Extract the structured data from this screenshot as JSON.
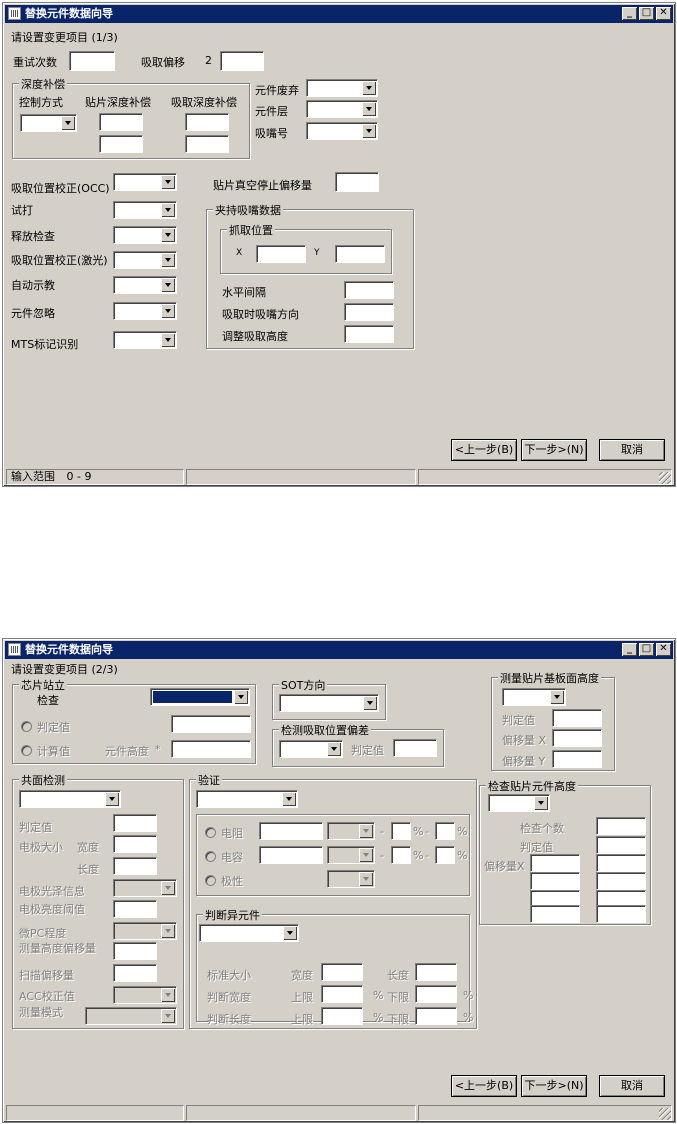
{
  "window1": {
    "title": "替换元件数据向导",
    "step_label": "请设置变更项目 (1/3)",
    "retry_count": "重试次数",
    "pickup_offset": "吸取偏移",
    "pickup_offset_value": "2",
    "depth_group": "深度补偿",
    "control_method": "控制方式",
    "place_depth_comp": "贴片深度补偿",
    "pickup_depth_comp": "吸取深度补偿",
    "part_discard": "元件废弃",
    "part_layer": "元件层",
    "nozzle_no": "吸嘴号",
    "pickup_pos_correct_occ": "吸取位置校正(OCC)",
    "trial": "试打",
    "release_check": "释放检查",
    "pickup_pos_correct_laser": "吸取位置校正(激光)",
    "auto_teach": "自动示教",
    "part_ignore": "元件忽略",
    "mts_mark": "MTS标记识别",
    "vacuum_stop_offset": "贴片真空停止偏移量",
    "clamp_nozzle_group": "夹持吸嘴数据",
    "grab_position": "抓取位置",
    "x": "X",
    "y": "Y",
    "horizontal_gap": "水平间隔",
    "nozzle_dir": "吸取时吸嘴方向",
    "adjust_height": "调整吸取高度",
    "prev": "<上一步(B)",
    "next": "下一步>(N)",
    "cancel": "取消",
    "status_range": "输入范围",
    "status_range_value": "0 - 9"
  },
  "window2": {
    "title": "替换元件数据向导",
    "step_label": "请设置变更项目 (2/3)",
    "chip_stand_group": "芯片站立",
    "check": "检查",
    "judge_value": "判定值",
    "calc_value": "计算值",
    "part_height": "元件高度",
    "asterisk": "*",
    "sot_group": "SOT方向",
    "detect_offset_group": "检测吸取位置偏差",
    "judge_value_short": "判定值",
    "measure_base_group": "测量贴片基板面高度",
    "offset_x": "偏移量 X",
    "offset_y": "偏移量 Y",
    "coplanar_group": "共面检测",
    "electrode_size": "电极大小",
    "width": "宽度",
    "length": "长度",
    "electrode_gloss": "电极光泽信息",
    "electrode_threshold": "电极亮度阈值",
    "pc_precision": "微PC程度",
    "measure_height_offset": "测量高度偏移量",
    "scan_offset": "扫描偏移量",
    "acc_correct": "ACC校正值",
    "measure_mode": "测量模式",
    "verify_group": "验证",
    "resistor": "电阻",
    "capacitor": "电容",
    "polarity": "极性",
    "dash": "-",
    "percent": "%",
    "judge_odd_group": "判断异元件",
    "std_size": "标准大小",
    "judge_width": "判断宽度",
    "judge_length": "判断长度",
    "upper": "上限",
    "lower": "下限",
    "inspect_height_group": "检查贴片元件高度",
    "check_count": "检查个数",
    "offset_xy": "偏移量X",
    "prev": "<上一步(B)",
    "next": "下一步>(N)",
    "cancel": "取消"
  }
}
